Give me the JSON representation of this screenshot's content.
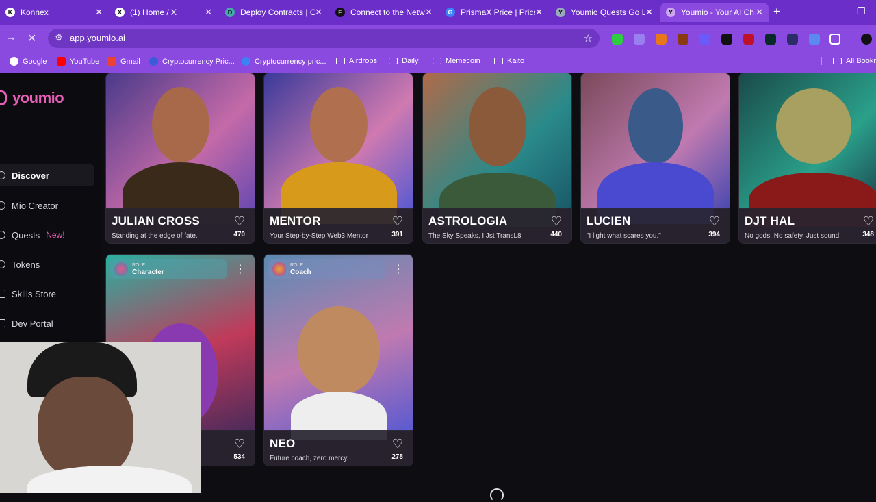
{
  "browser": {
    "tabs": [
      {
        "label": "Konnex",
        "fav": "K"
      },
      {
        "label": "(1) Home / X",
        "fav": "X"
      },
      {
        "label": "Deploy Contracts | O",
        "fav": "D"
      },
      {
        "label": "Connect to the Netw",
        "fav": "F"
      },
      {
        "label": "PrismaX Price | Price",
        "fav": "G"
      },
      {
        "label": "Youmio Quests Go Li",
        "fav": "Y"
      },
      {
        "label": "Youmio - Your AI Ch",
        "fav": "Y"
      }
    ],
    "url": "app.youmio.ai",
    "bookmarks": [
      {
        "label": "Google",
        "type": "site"
      },
      {
        "label": "YouTube",
        "type": "site"
      },
      {
        "label": "Gmail",
        "type": "site"
      },
      {
        "label": "Cryptocurrency Pric...",
        "type": "site"
      },
      {
        "label": "Cryptocurrency pric...",
        "type": "site"
      },
      {
        "label": "Airdrops",
        "type": "folder"
      },
      {
        "label": "Daily",
        "type": "folder"
      },
      {
        "label": "Memecoin",
        "type": "folder"
      },
      {
        "label": "Kaito",
        "type": "folder"
      },
      {
        "label": "All Bookm",
        "type": "folder"
      }
    ]
  },
  "app": {
    "logo": "youmio",
    "nav": [
      {
        "label": "Discover",
        "icon": "compass-icon",
        "active": true
      },
      {
        "label": "Mio Creator",
        "icon": "plus-circle-icon"
      },
      {
        "label": "Quests",
        "icon": "target-icon",
        "badge": "New!"
      },
      {
        "label": "Tokens",
        "icon": "token-icon"
      },
      {
        "label": "Skills Store",
        "icon": "store-icon"
      },
      {
        "label": "Dev Portal",
        "icon": "code-icon"
      }
    ],
    "cards": [
      {
        "name": "JULIAN CROSS",
        "tagline": "Standing at the edge of fate.",
        "likes": "470"
      },
      {
        "name": "MENTOR",
        "tagline": "Your Step-by-Step Web3 Mentor",
        "likes": "391"
      },
      {
        "name": "ASTROLOGIA",
        "tagline": "The Sky Speaks, I Jst TransL8",
        "likes": "440"
      },
      {
        "name": "LUCIEN",
        "tagline": "\"I light what scares you.\"",
        "likes": "394"
      },
      {
        "name": "DJT HAL",
        "tagline": "No gods. No safety. Just sound",
        "likes": "348"
      },
      {
        "name": "",
        "tagline": "",
        "likes": "534",
        "role_label": "ROLE",
        "role": "Character"
      },
      {
        "name": "NEO",
        "tagline": "Future coach, zero mercy.",
        "likes": "278",
        "role_label": "ROLE",
        "role": "Coach"
      }
    ]
  }
}
